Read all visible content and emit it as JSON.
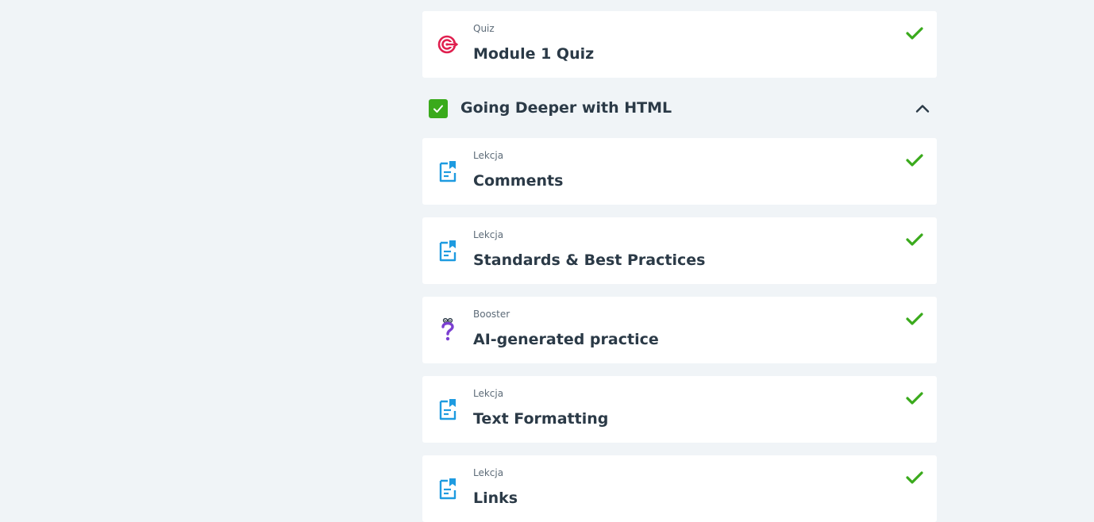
{
  "top_item": {
    "type": "Quiz",
    "title": "Module 1 Quiz",
    "icon": "target-icon",
    "completed": true
  },
  "section": {
    "title": "Going Deeper with HTML",
    "completed": true,
    "expanded": true
  },
  "items": [
    {
      "type": "Lekcja",
      "title": "Comments",
      "icon": "lesson-document-icon",
      "completed": true
    },
    {
      "type": "Lekcja",
      "title": "Standards & Best Practices",
      "icon": "lesson-document-icon",
      "completed": true
    },
    {
      "type": "Booster",
      "title": "AI-generated practice",
      "icon": "question-mark-icon",
      "completed": true
    },
    {
      "type": "Lekcja",
      "title": "Text Formatting",
      "icon": "lesson-document-icon",
      "completed": true
    },
    {
      "type": "Lekcja",
      "title": "Links",
      "icon": "lesson-document-icon",
      "completed": true
    }
  ],
  "colors": {
    "background": "#f0f4f7",
    "check_green": "#3aaa1c",
    "quiz_icon": "#e0204f",
    "lesson_icon": "#1e9be0",
    "booster_icon": "#7b3fd1",
    "text": "#2b3a47"
  }
}
